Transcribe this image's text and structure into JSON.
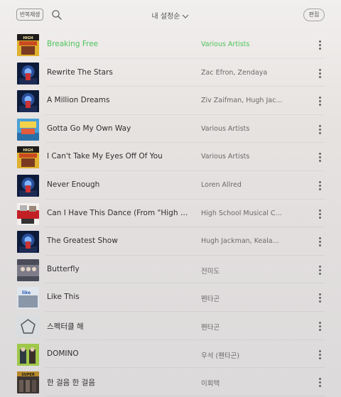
{
  "header": {
    "repeat_label": "반복재생",
    "sort_label": "내 설정순",
    "edit_label": "편집"
  },
  "colors": {
    "playing": "#4fc45b"
  },
  "tracks": [
    {
      "title": "Breaking Free",
      "artist": "Various Artists",
      "playing": true,
      "art": "hsm-yellow"
    },
    {
      "title": "Rewrite The Stars",
      "artist": "Zac Efron, Zendaya",
      "playing": false,
      "art": "greatest-showman"
    },
    {
      "title": "A Million Dreams",
      "artist": "Ziv Zaifman, Hugh Jac...",
      "playing": false,
      "art": "greatest-showman"
    },
    {
      "title": "Gotta Go My Own Way",
      "artist": "Various Artists",
      "playing": false,
      "art": "hsm2-blue"
    },
    {
      "title": "I Can't Take My Eyes Off Of You",
      "artist": "Various Artists",
      "playing": false,
      "art": "hsm-yellow"
    },
    {
      "title": "Never Enough",
      "artist": "Loren Allred",
      "playing": false,
      "art": "greatest-showman"
    },
    {
      "title": "Can I Have This Dance (From \"High Sch...",
      "artist": "High School Musical C...",
      "playing": false,
      "art": "hsm3-red"
    },
    {
      "title": "The Greatest Show",
      "artist": "Hugh Jackman, Keala...",
      "playing": false,
      "art": "greatest-showman"
    },
    {
      "title": "Butterfly",
      "artist": "전미도",
      "playing": false,
      "art": "photo-group"
    },
    {
      "title": "Like This",
      "artist": "펜타곤",
      "playing": false,
      "art": "photo-light"
    },
    {
      "title": "스펙터클 해",
      "artist": "펜타곤",
      "playing": false,
      "art": "pentagon-logo"
    },
    {
      "title": "DOMINO",
      "artist": "우석 (펜타곤)",
      "playing": false,
      "art": "photo-green"
    },
    {
      "title": "한 걸음 한 걸음",
      "artist": "이회택",
      "playing": false,
      "art": "photo-dark"
    }
  ]
}
